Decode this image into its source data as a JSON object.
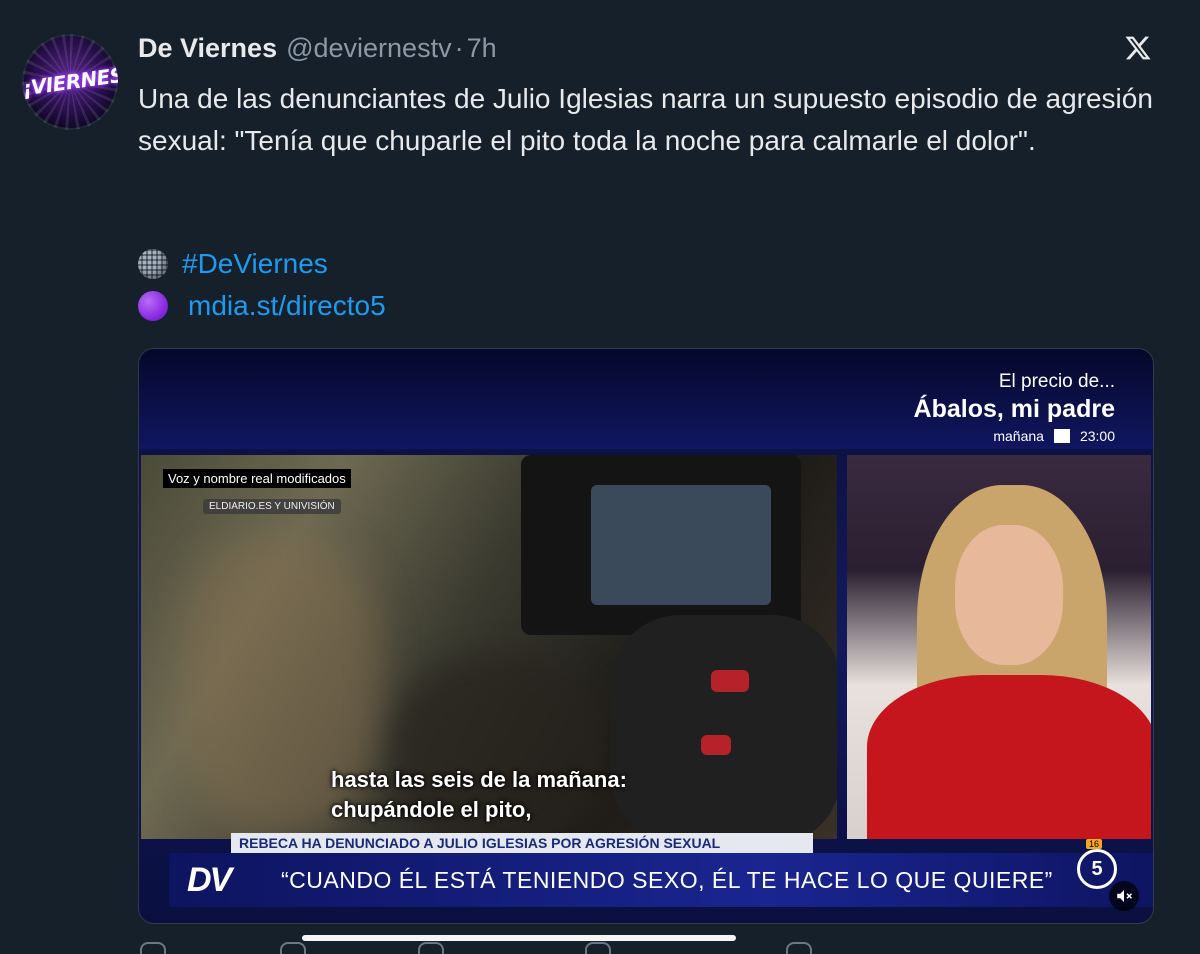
{
  "tweet": {
    "author_name": "De Viernes",
    "author_handle": "@deviernestv",
    "separator": "·",
    "time": "7h",
    "avatar_text": "¡VIERNES!",
    "text": "Una de las denunciantes de Julio Iglesias narra un supuesto episodio de agresión sexual: \"Tenía que chuparle el pito toda la noche para calmarle el dolor\".",
    "hashtag": "#DeViernes",
    "link": "mdia.st/directo5"
  },
  "video": {
    "promo_line1": "El precio de...",
    "promo_line2": "Ábalos, mi padre",
    "promo_day": "mañana",
    "promo_time": "23:00",
    "tag_voice": "Voz y nombre real modificados",
    "tag_source": "ELDIARIO.ES Y UNIVISIÓN",
    "subtitle_line1": "hasta las seis de la mañana:",
    "subtitle_line2": "chupándole el pito,",
    "lower_third": "REBECA HA DENUNCIADO A JULIO IGLESIAS POR AGRESIÓN SEXUAL",
    "program_logo": "DV",
    "quote": "“CUANDO ÉL ESTÁ TENIENDO SEXO, ÉL TE HACE LO QUE QUIERE”",
    "channel": "5",
    "rating": "16"
  },
  "icons": {
    "close": "x-logo-icon",
    "mute": "muted-speaker-icon"
  }
}
